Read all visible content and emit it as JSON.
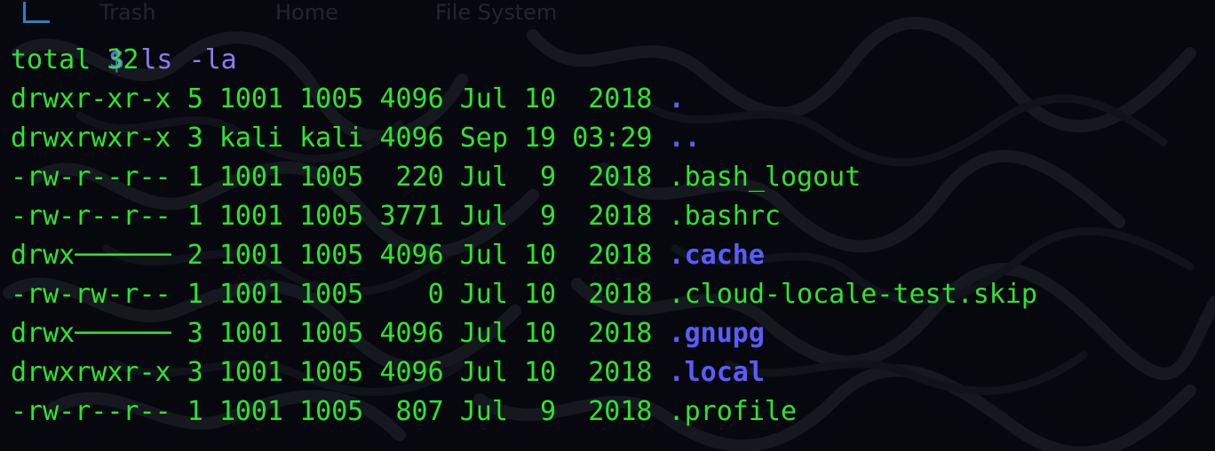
{
  "desktop": {
    "icon_labels": [
      "Trash",
      "Home",
      "File System"
    ]
  },
  "terminal": {
    "prompt_symbol": "$",
    "command": "ls -la",
    "total_line": "total 32",
    "entries": [
      {
        "perms": "drwxr-xr-x",
        "links": "5",
        "owner": "1001",
        "group": "1005",
        "size": "4096",
        "month": "Jul",
        "day": "10",
        "time": " 2018",
        "name": ".",
        "type": "dir"
      },
      {
        "perms": "drwxrwxr-x",
        "links": "3",
        "owner": "kali",
        "group": "kali",
        "size": "4096",
        "month": "Sep",
        "day": "19",
        "time": "03:29",
        "name": "..",
        "type": "dir"
      },
      {
        "perms": "-rw-r--r--",
        "links": "1",
        "owner": "1001",
        "group": "1005",
        "size": " 220",
        "month": "Jul",
        "day": " 9",
        "time": " 2018",
        "name": ".bash_logout",
        "type": "file"
      },
      {
        "perms": "-rw-r--r--",
        "links": "1",
        "owner": "1001",
        "group": "1005",
        "size": "3771",
        "month": "Jul",
        "day": " 9",
        "time": " 2018",
        "name": ".bashrc",
        "type": "file"
      },
      {
        "perms": "drwx──────",
        "links": "2",
        "owner": "1001",
        "group": "1005",
        "size": "4096",
        "month": "Jul",
        "day": "10",
        "time": " 2018",
        "name": ".cache",
        "type": "dir"
      },
      {
        "perms": "-rw-rw-r--",
        "links": "1",
        "owner": "1001",
        "group": "1005",
        "size": "   0",
        "month": "Jul",
        "day": "10",
        "time": " 2018",
        "name": ".cloud-locale-test.skip",
        "type": "file"
      },
      {
        "perms": "drwx──────",
        "links": "3",
        "owner": "1001",
        "group": "1005",
        "size": "4096",
        "month": "Jul",
        "day": "10",
        "time": " 2018",
        "name": ".gnupg",
        "type": "dir"
      },
      {
        "perms": "drwxrwxr-x",
        "links": "3",
        "owner": "1001",
        "group": "1005",
        "size": "4096",
        "month": "Jul",
        "day": "10",
        "time": " 2018",
        "name": ".local",
        "type": "dir"
      },
      {
        "perms": "-rw-r--r--",
        "links": "1",
        "owner": "1001",
        "group": "1005",
        "size": " 807",
        "month": "Jul",
        "day": " 9",
        "time": " 2018",
        "name": ".profile",
        "type": "file"
      }
    ]
  },
  "colors": {
    "background": "#07080d",
    "text_green": "#2ee52e",
    "directory_blue": "#5a5cff",
    "prompt_purple": "#8b7cf5",
    "prompt_corner_blue": "#2c7fc4"
  }
}
